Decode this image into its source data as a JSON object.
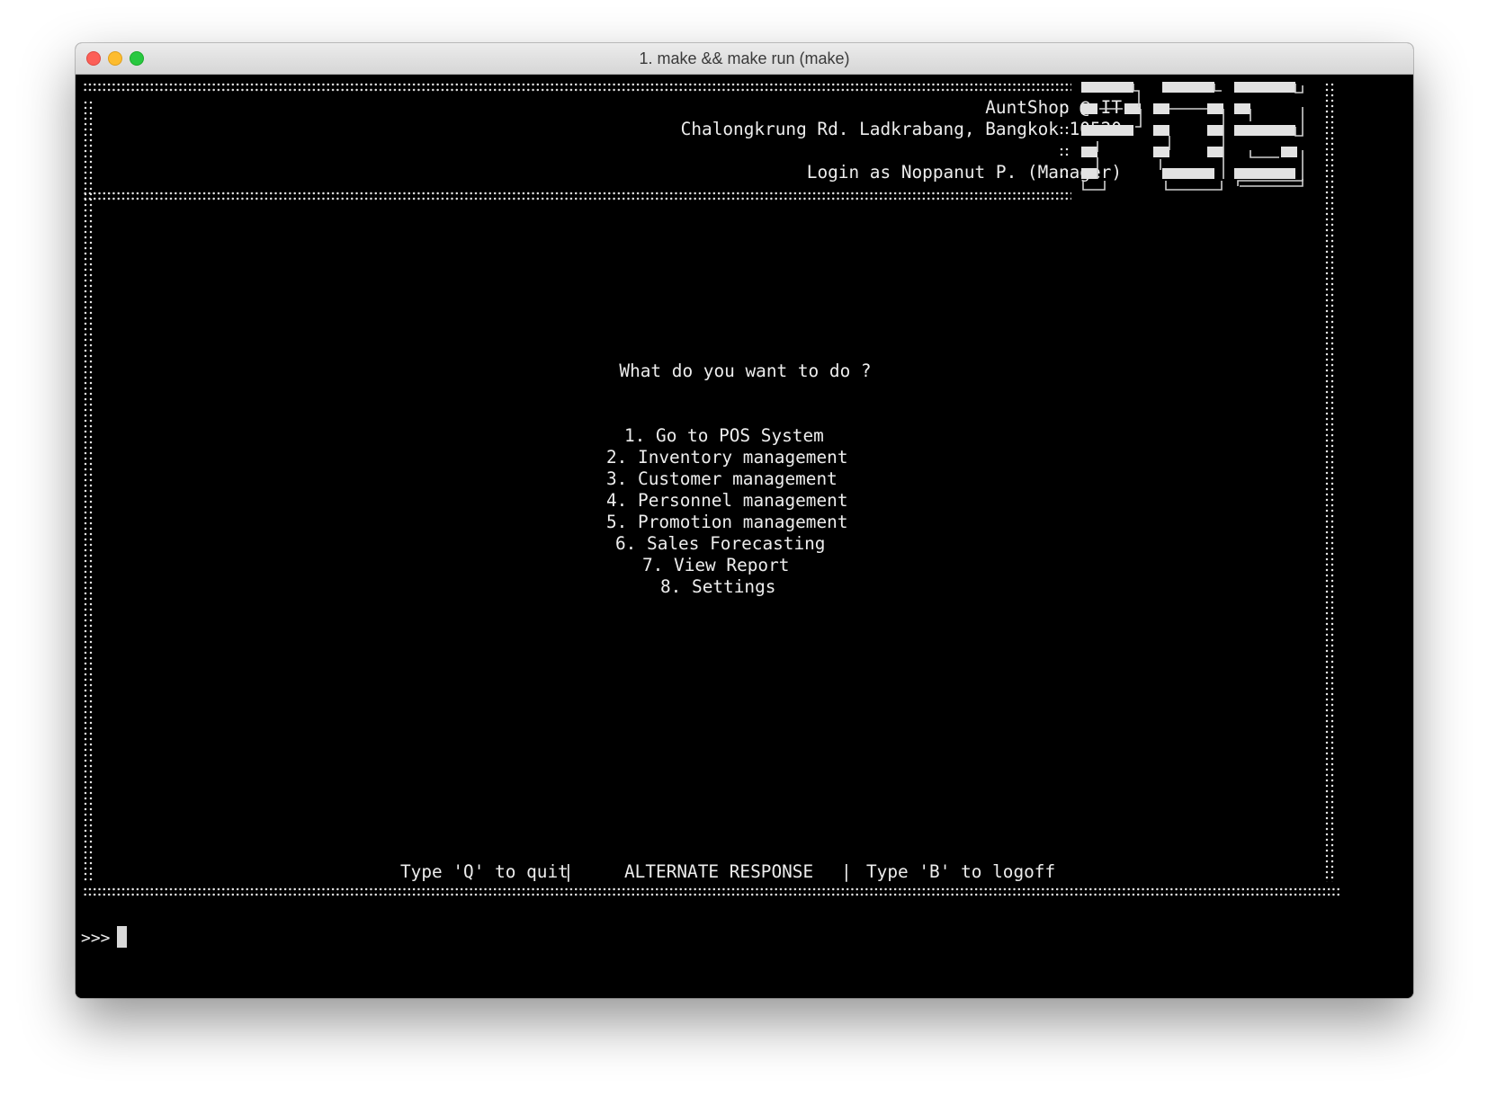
{
  "window": {
    "title": "1. make && make run (make)",
    "controls": [
      "close",
      "minimize",
      "zoom"
    ],
    "colors": {
      "close": "#fc5f57",
      "minimize": "#fdbc2e",
      "zoom": "#28c840",
      "terminal_bg": "#000000",
      "terminal_fg": "#ededed"
    }
  },
  "header": {
    "shop_name": "AuntShop @ IT",
    "address": "Chalongkrung Rd. Ladkrabang, Bangkok 10520",
    "login": "Login as Noppanut P. (Manager)",
    "logo_text": "POS"
  },
  "menu": {
    "question": "What do you want to do ?",
    "items": [
      "1. Go to POS System",
      "2. Inventory management",
      "3. Customer management",
      "4. Personnel management",
      "5. Promotion management",
      "6. Sales Forecasting",
      "7. View Report",
      "8. Settings"
    ]
  },
  "footer": {
    "quit_hint": "Type 'Q' to quit",
    "separator": "|",
    "alternate": "ALTERNATE RESPONSE",
    "logoff_hint": "Type 'B' to logoff"
  },
  "prompt": {
    "symbol": ">>>",
    "value": ""
  }
}
